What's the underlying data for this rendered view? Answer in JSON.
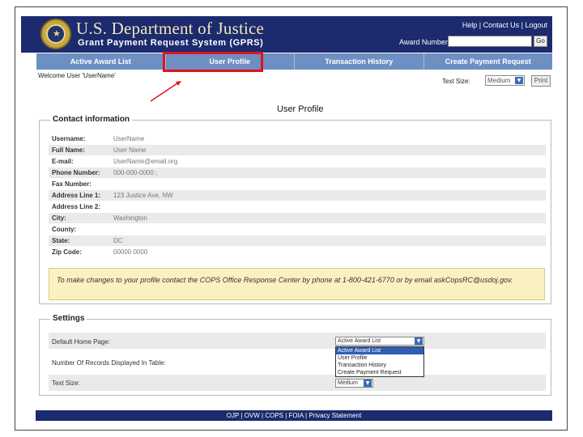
{
  "header": {
    "department": "U.S. Department of Justice",
    "system": "Grant Payment Request System (GPRS)",
    "top_links": [
      "Help",
      "Contact Us",
      "Logout"
    ],
    "award_label": "Award Number:",
    "award_value": "",
    "go_label": "Go"
  },
  "nav": {
    "items": [
      "Active Award List",
      "User Profile",
      "Transaction History",
      "Create Payment Request"
    ],
    "active_index": 1
  },
  "subbar": {
    "welcome": "Welcome User 'UserName'",
    "text_size_label": "Text Size:",
    "text_size_value": "Medium",
    "print_label": "Print"
  },
  "page_title": "User Profile",
  "contact": {
    "legend": "Contact information",
    "fields": [
      {
        "label": "Username:",
        "value": "UserName"
      },
      {
        "label": "Full Name:",
        "value": "User Name"
      },
      {
        "label": "E-mail:",
        "value": "UserName@email.org"
      },
      {
        "label": "Phone Number:",
        "value": "000-000-0000 ;"
      },
      {
        "label": "Fax Number:",
        "value": ""
      },
      {
        "label": "Address Line 1:",
        "value": "123 Justice Ave, NW"
      },
      {
        "label": "Address Line 2:",
        "value": ""
      },
      {
        "label": "City:",
        "value": "Washington"
      },
      {
        "label": "County:",
        "value": ""
      },
      {
        "label": "State:",
        "value": "DC"
      },
      {
        "label": "Zip Code:",
        "value": "00000 0000"
      }
    ],
    "notice": "To make changes to your profile contact the COPS Office Response Center by phone at 1-800-421-6770 or by email askCopsRC@usdoj.gov."
  },
  "settings": {
    "legend": "Settings",
    "default_home_label": "Default Home Page:",
    "default_home_value": "Active Award List",
    "default_home_options": [
      "Active Award List",
      "User Profile",
      "Transaction History",
      "Create Payment Request"
    ],
    "records_label": "Number Of Records Displayed In Table:",
    "text_size_label": "Text Size:",
    "text_size_value": "Medium"
  },
  "footer": {
    "links": [
      "OJP",
      "OVW",
      "COPS",
      "FOIA",
      "Privacy Statement"
    ]
  },
  "colors": {
    "header_bg": "#1c2a6e",
    "nav_bg": "#6d8fc2",
    "highlight": "#e0131d",
    "notice_bg": "#fbf1c0"
  }
}
